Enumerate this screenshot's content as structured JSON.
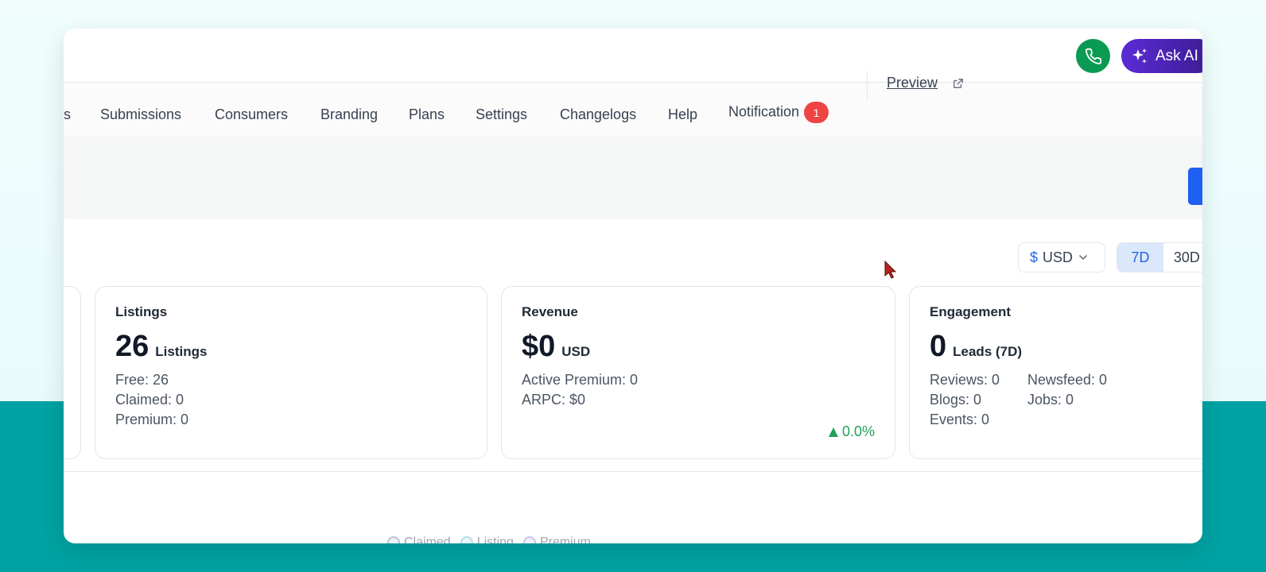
{
  "header": {
    "ask_ai_label": "Ask AI"
  },
  "nav": {
    "items": [
      {
        "label": "s"
      },
      {
        "label": "Submissions"
      },
      {
        "label": "Consumers"
      },
      {
        "label": "Branding"
      },
      {
        "label": "Plans"
      },
      {
        "label": "Settings"
      },
      {
        "label": "Changelogs"
      },
      {
        "label": "Help"
      },
      {
        "label": "Notification",
        "badge": "1"
      }
    ],
    "preview_label": "Preview"
  },
  "filters": {
    "currency_symbol": "$",
    "currency": "USD",
    "range_active": "7D",
    "range_other": "30D"
  },
  "cards": {
    "listings": {
      "label": "Listings",
      "value": "26",
      "unit": "Listings",
      "stats": [
        "Free: 26",
        "Claimed: 0",
        "Premium: 0"
      ]
    },
    "revenue": {
      "label": "Revenue",
      "value": "$0",
      "unit": "USD",
      "stats": [
        "Active Premium: 0",
        "ARPC: $0"
      ],
      "trend": "0.0%"
    },
    "engagement": {
      "label": "Engagement",
      "value": "0",
      "unit": "Leads (7D)",
      "stats_left": [
        "Reviews: 0",
        "Blogs: 0",
        "Events: 0"
      ],
      "stats_right": [
        "Newsfeed: 0",
        "Jobs: 0"
      ]
    }
  },
  "chart_legend": [
    "Claimed",
    "Listing",
    "Premium"
  ],
  "colors": {
    "accent_blue": "#2563eb",
    "call_green": "#0b9a52",
    "ai_purple": "#5b2bd6",
    "badge_red": "#ef4444",
    "trend_green": "#22a05a",
    "backdrop_teal": "#00a2a3"
  }
}
